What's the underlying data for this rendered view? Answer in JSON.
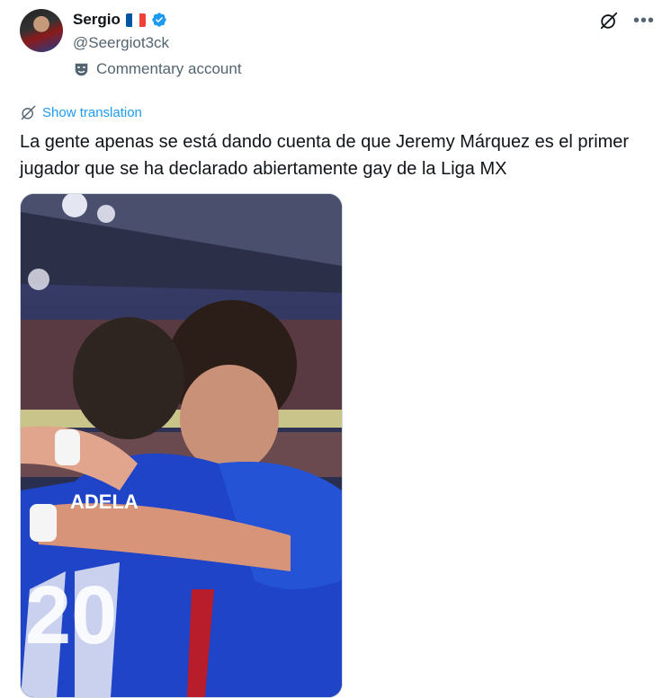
{
  "author": {
    "display_name": "Sergio",
    "handle": "@Seergiot3ck",
    "flag": "france-flag",
    "verified": true,
    "label": "Commentary account"
  },
  "actions": {
    "grok_icon": "grok-icon",
    "more_icon": "more-icon"
  },
  "translation": {
    "label": "Show translation"
  },
  "tweet": {
    "text": "La gente apenas se está dando cuenta de que Jeremy Márquez es el primer jugador que se ha declarado abiertamente gay de la Liga MX"
  },
  "media": {
    "kind": "video-still",
    "jersey_number": "20",
    "jersey_name": "ADELA"
  },
  "colors": {
    "accent": "#1d9bf0",
    "secondary_text": "#536471",
    "jersey_blue": "#1f44c8"
  }
}
